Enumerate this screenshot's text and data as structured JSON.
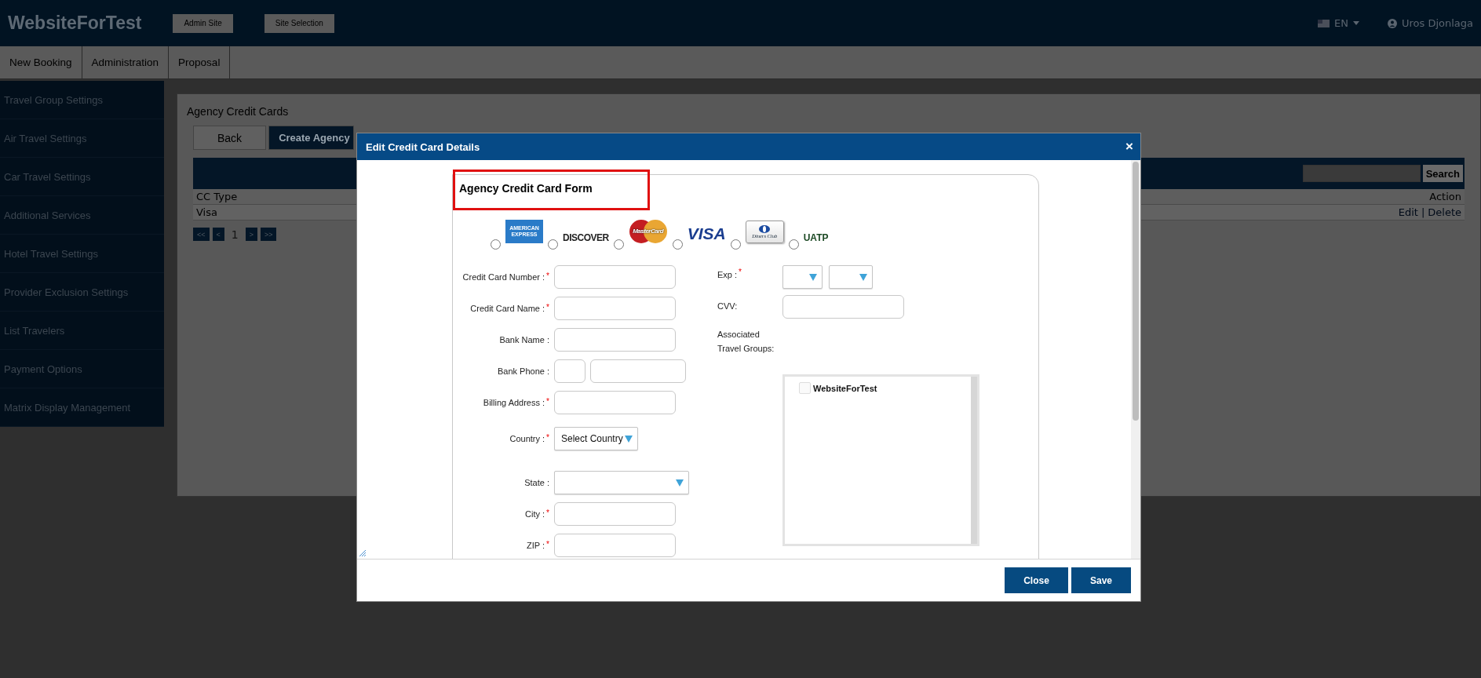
{
  "header": {
    "logo": "WebsiteForTest",
    "buttons": [
      "Admin Site",
      "Site Selection"
    ],
    "language": "EN",
    "user": "Uros Djonlaga"
  },
  "nav": [
    "New Booking",
    "Administration",
    "Proposal"
  ],
  "sidebar": {
    "items": [
      "Travel Group Settings",
      "Air Travel Settings",
      "Car Travel Settings",
      "Additional Services",
      "Hotel Travel Settings",
      "Provider Exclusion Settings",
      "List Travelers",
      "Payment Options",
      "Matrix Display Management"
    ]
  },
  "content": {
    "title": "Agency Credit Cards",
    "tabs": [
      {
        "label": "Back",
        "selected": false
      },
      {
        "label": "Create Agency",
        "selected": true
      }
    ],
    "search_button": "Search",
    "table": {
      "columns": [
        "CC Type",
        "Action"
      ],
      "rows": [
        {
          "cc_type": "Visa",
          "actions": [
            "Edit",
            "Delete"
          ],
          "separator": "|"
        }
      ]
    },
    "pager": [
      {
        "label": "<<",
        "kind": "button"
      },
      {
        "label": "<",
        "kind": "button"
      },
      {
        "label": "1",
        "kind": "current"
      },
      {
        "label": ">",
        "kind": "button"
      },
      {
        "label": ">>",
        "kind": "button"
      }
    ]
  },
  "modal": {
    "title": "Edit Credit Card Details",
    "close": "×",
    "form_title": "Agency Credit Card Form",
    "cards": [
      {
        "kind": "amex",
        "texts": [
          "AMERICAN",
          "EXPRESS"
        ],
        "selected": false
      },
      {
        "kind": "discover",
        "texts": [
          "DISCOVER"
        ],
        "selected": false
      },
      {
        "kind": "mastercard",
        "texts": [
          "MasterCard"
        ],
        "selected": false
      },
      {
        "kind": "visa",
        "texts": [
          "VISA"
        ],
        "selected": false
      },
      {
        "kind": "diners",
        "texts": [
          "Diners Club"
        ],
        "selected": false
      },
      {
        "kind": "uatp",
        "texts": [
          "UATP"
        ],
        "selected": false
      }
    ],
    "left_fields": [
      {
        "label": "Credit Card Number :",
        "required_mark": "*",
        "kind": "text"
      },
      {
        "label": "Credit Card Name :",
        "required_mark": "*",
        "kind": "text"
      },
      {
        "label": "Bank Name :",
        "kind": "text"
      },
      {
        "label": "Bank Phone :",
        "kind": "phone"
      },
      {
        "label": "Billing Address :",
        "required_mark": "*",
        "kind": "text"
      },
      {
        "label": "Country :",
        "required_mark": "*",
        "kind": "select",
        "value": "Select Country"
      },
      {
        "label": "State :",
        "kind": "wide-select"
      },
      {
        "label": "City :",
        "required_mark": "*",
        "kind": "text"
      },
      {
        "label": "ZIP :",
        "required_mark": "*",
        "kind": "text"
      }
    ],
    "right_fields": [
      {
        "label": "Exp :",
        "required_mark": "*",
        "kind": "exp"
      },
      {
        "label": "CVV:",
        "kind": "text"
      },
      {
        "label": "Associated Travel Groups:",
        "kind": "groups",
        "items": [
          {
            "label": "WebsiteForTest",
            "checked": false
          }
        ]
      }
    ],
    "buttons": [
      "Close",
      "Save"
    ]
  }
}
